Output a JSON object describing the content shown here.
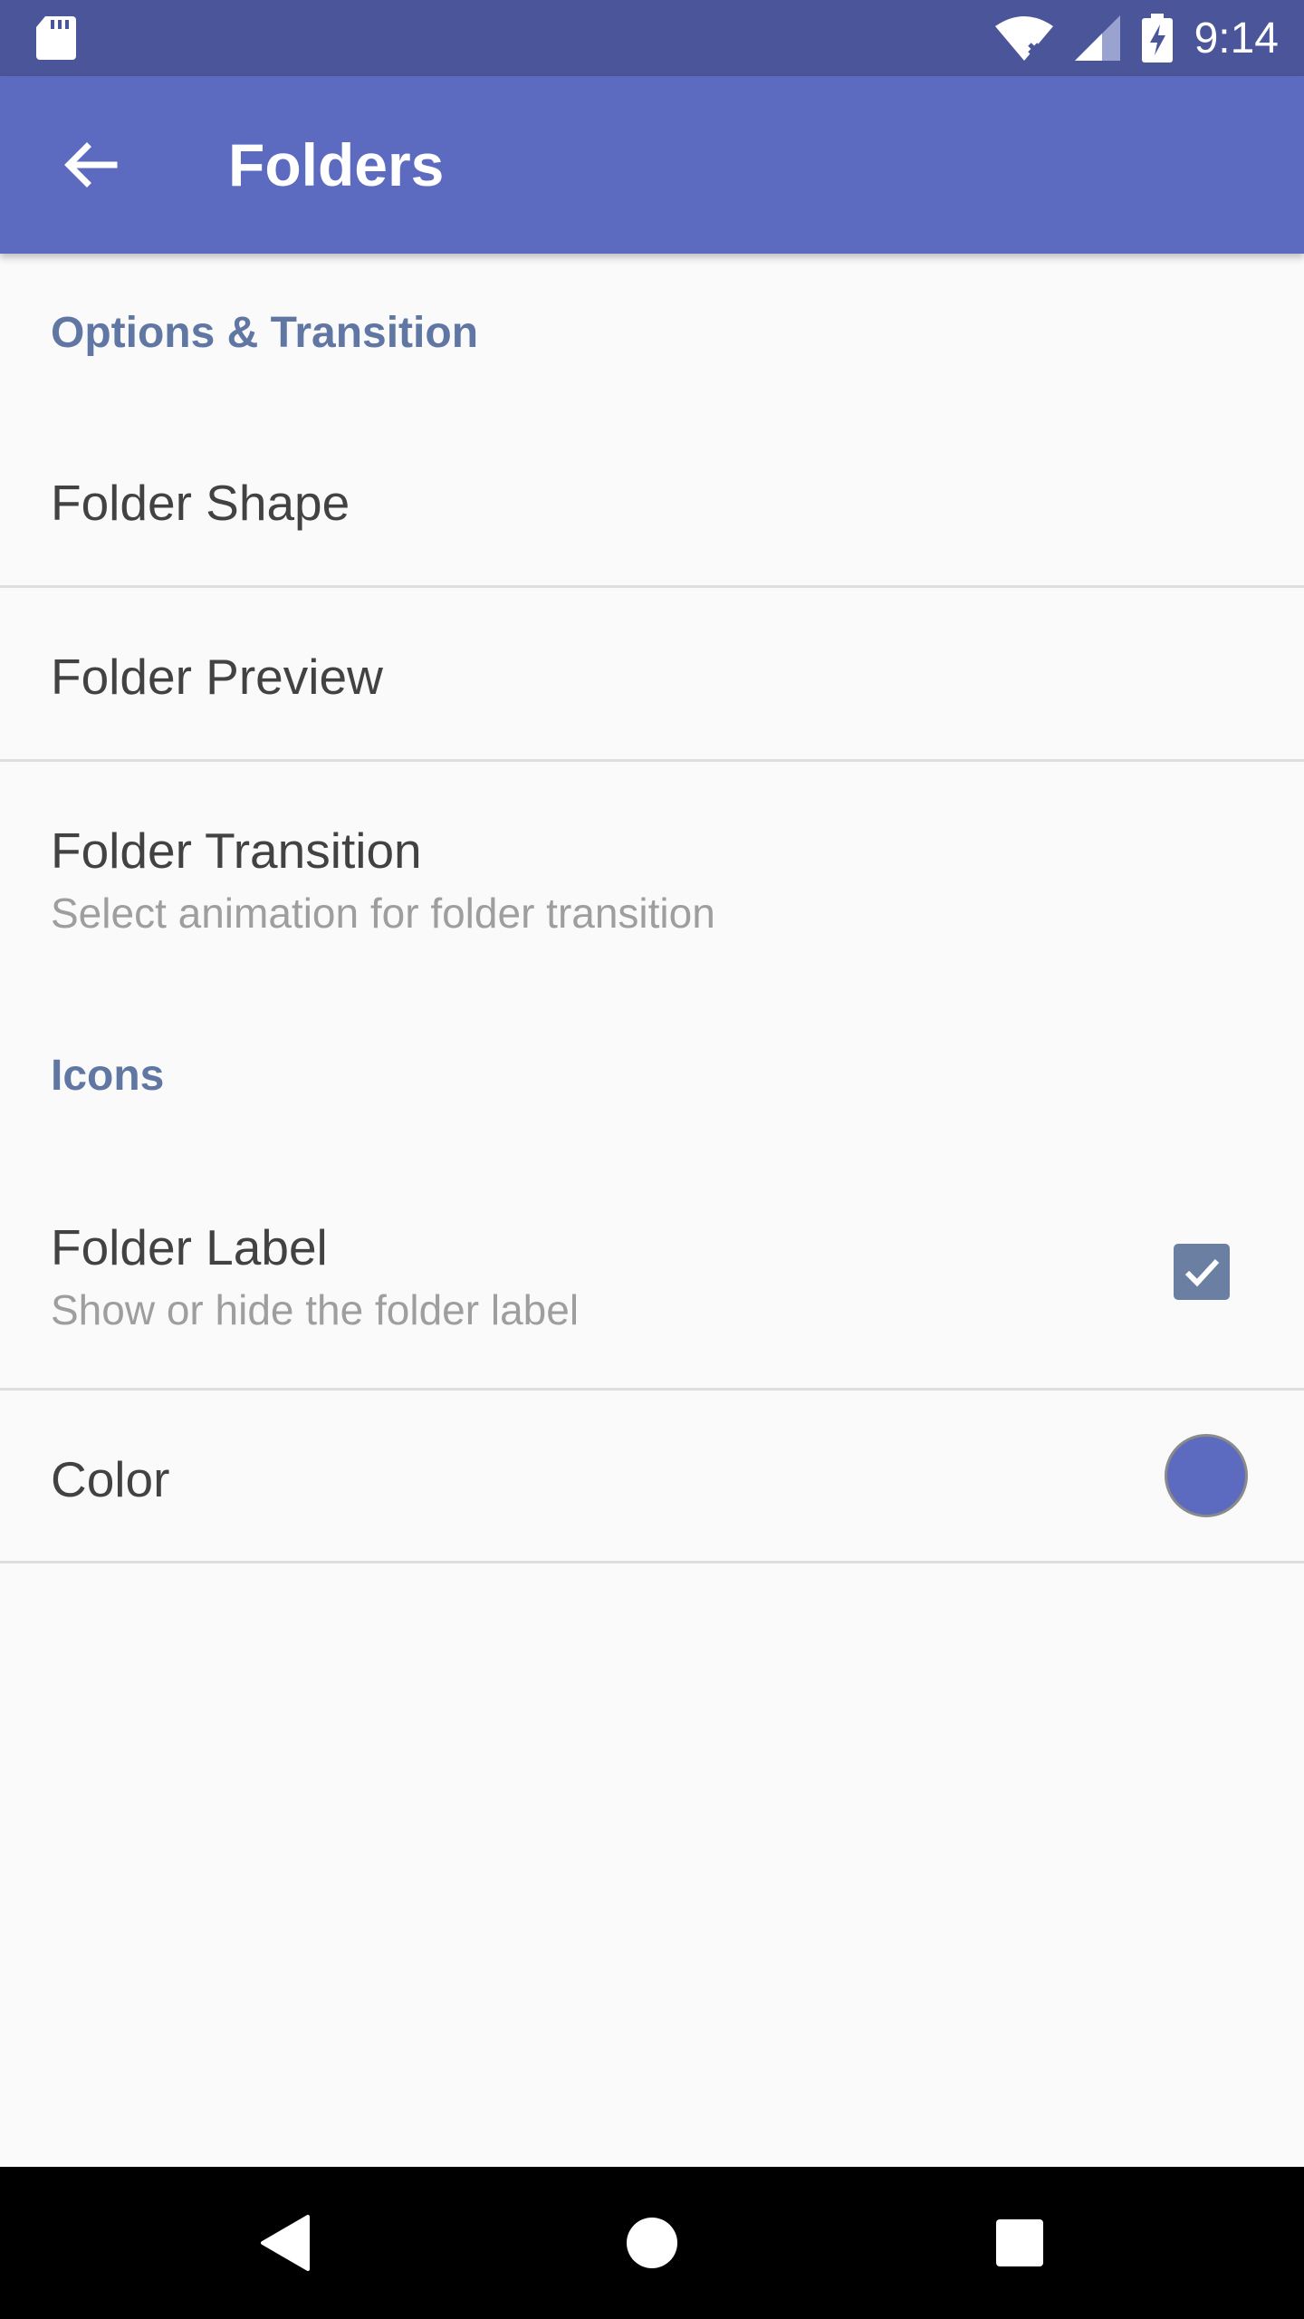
{
  "status_bar": {
    "time": "9:14",
    "icons": [
      "sd-card-icon",
      "wifi-icon",
      "cell-signal-icon",
      "battery-charging-icon"
    ]
  },
  "app_bar": {
    "title": "Folders",
    "back_icon": "back-arrow-icon",
    "background_color": "#5c6bc0"
  },
  "sections": {
    "options": {
      "header": "Options & Transition",
      "folder_shape": {
        "title": "Folder Shape"
      },
      "folder_preview": {
        "title": "Folder Preview"
      },
      "folder_transition": {
        "title": "Folder Transition",
        "summary": "Select animation for folder transition"
      }
    },
    "icons": {
      "header": "Icons",
      "folder_label": {
        "title": "Folder Label",
        "summary": "Show or hide the folder label",
        "checked": true
      },
      "color": {
        "title": "Color",
        "swatch_color": "#5c6bc0"
      }
    }
  },
  "accent_color": "#6077a4",
  "nav_bar": {
    "buttons": [
      "back-triangle-icon",
      "home-circle-icon",
      "recents-square-icon"
    ]
  }
}
